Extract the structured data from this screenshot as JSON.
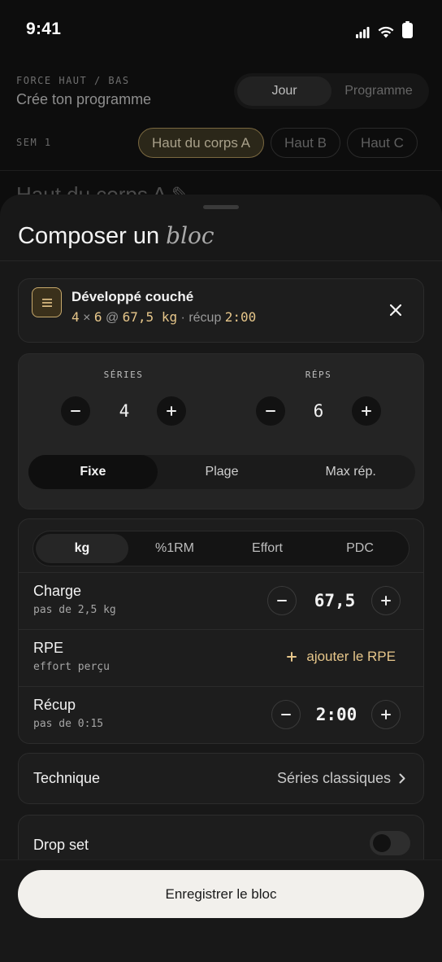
{
  "status_bar": {
    "time": "9:41"
  },
  "background": {
    "eyebrow": "FORCE HAUT / BAS",
    "title": "Crée ton programme",
    "view_toggle": [
      "Jour",
      "Programme"
    ],
    "week_label": "SEM 1",
    "days": [
      "Haut du corps A",
      "Haut B",
      "Haut C"
    ],
    "peek_title": "Haut du corps A"
  },
  "sheet": {
    "title_plain": "Composer un ",
    "title_emphasis": "bloc",
    "exercise": {
      "name": "Développé couché",
      "sets": "4",
      "times": " × ",
      "reps": "6",
      "at": " @ ",
      "load": "67,5 kg",
      "rest_prefix": " · récup ",
      "rest": "2:00"
    },
    "sets_reps": {
      "series_label": "SÉRIES",
      "series_value": "4",
      "reps_label": "RÉPS",
      "reps_value": "6",
      "modes": [
        "Fixe",
        "Plage",
        "Max rép."
      ],
      "active_mode": "Fixe"
    },
    "load": {
      "units": [
        "kg",
        "%1RM",
        "Effort",
        "PDC"
      ],
      "active_unit": "kg",
      "charge_label": "Charge",
      "charge_sub": "pas de 2,5 kg",
      "charge_value": "67,5",
      "rpe_label": "RPE",
      "rpe_sub": "effort perçu",
      "rpe_action": "ajouter le RPE",
      "rest_label": "Récup",
      "rest_sub": "pas de 0:15",
      "rest_value": "2:00"
    },
    "technique": {
      "label": "Technique",
      "value": "Séries classiques"
    },
    "drop_set": {
      "label": "Drop set",
      "enabled": false
    },
    "save_label": "Enregistrer le bloc"
  },
  "colors": {
    "accent": "#e6c68a",
    "sheet": "#181818",
    "primary_button": "#f2f0ec"
  }
}
